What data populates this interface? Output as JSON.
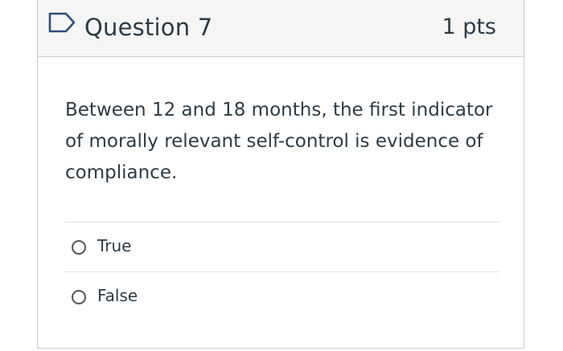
{
  "question": {
    "title": "Question 7",
    "points": "1 pts",
    "flag_icon": "flag-outline-icon",
    "text": "Between 12 and 18 months, the first indicator of morally relevant self-control is evidence of compliance."
  },
  "answers": [
    {
      "label": "True",
      "selected": false
    },
    {
      "label": "False",
      "selected": false
    }
  ],
  "colors": {
    "flag": "#2f4f7a",
    "header_bg": "#f5f5f5",
    "border": "#c7cdd1",
    "text": "#2d3b45"
  }
}
